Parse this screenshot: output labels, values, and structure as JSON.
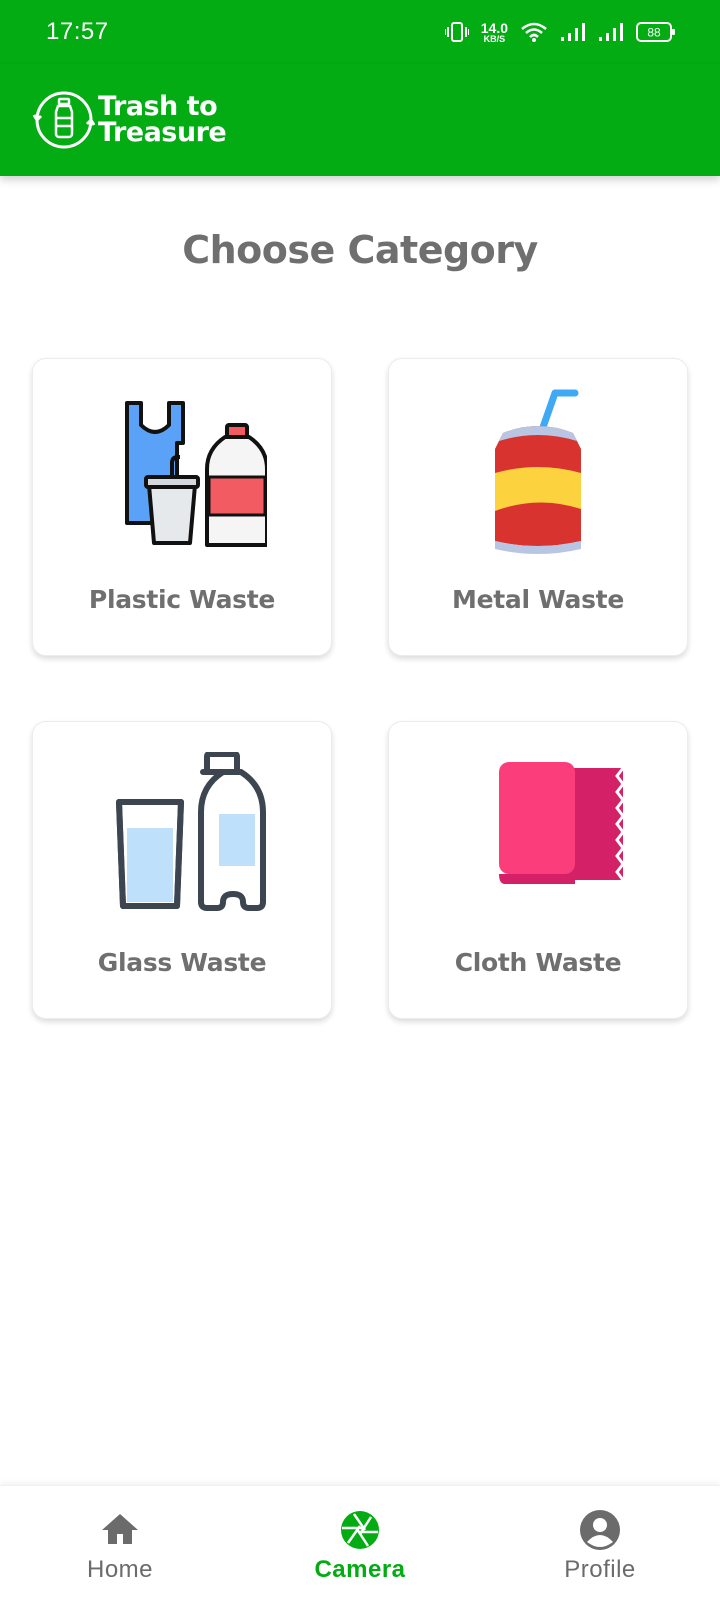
{
  "status_bar": {
    "time": "17:57",
    "net_speed_value": "14.0",
    "net_speed_unit": "KB/S",
    "battery": "88",
    "icons": [
      "vibrate-icon",
      "wifi-icon",
      "signal-icon",
      "signal-icon",
      "battery-icon"
    ]
  },
  "app_bar": {
    "logo_line1": "Trash to",
    "logo_line2": "Treasure",
    "background_color": "#03ac13"
  },
  "main": {
    "title": "Choose Category",
    "categories": [
      {
        "label": "Plastic Waste",
        "icon": "plastic-waste-icon"
      },
      {
        "label": "Metal Waste",
        "icon": "metal-can-icon"
      },
      {
        "label": "Glass Waste",
        "icon": "glass-bottle-icon"
      },
      {
        "label": "Cloth Waste",
        "icon": "cloth-towel-icon"
      }
    ]
  },
  "bottom_nav": {
    "items": [
      {
        "label": "Home",
        "icon": "home-icon",
        "active": false
      },
      {
        "label": "Camera",
        "icon": "camera-shutter-icon",
        "active": true
      },
      {
        "label": "Profile",
        "icon": "profile-icon",
        "active": false
      }
    ],
    "active_color": "#03ac13",
    "inactive_color": "#6b6b6b"
  }
}
